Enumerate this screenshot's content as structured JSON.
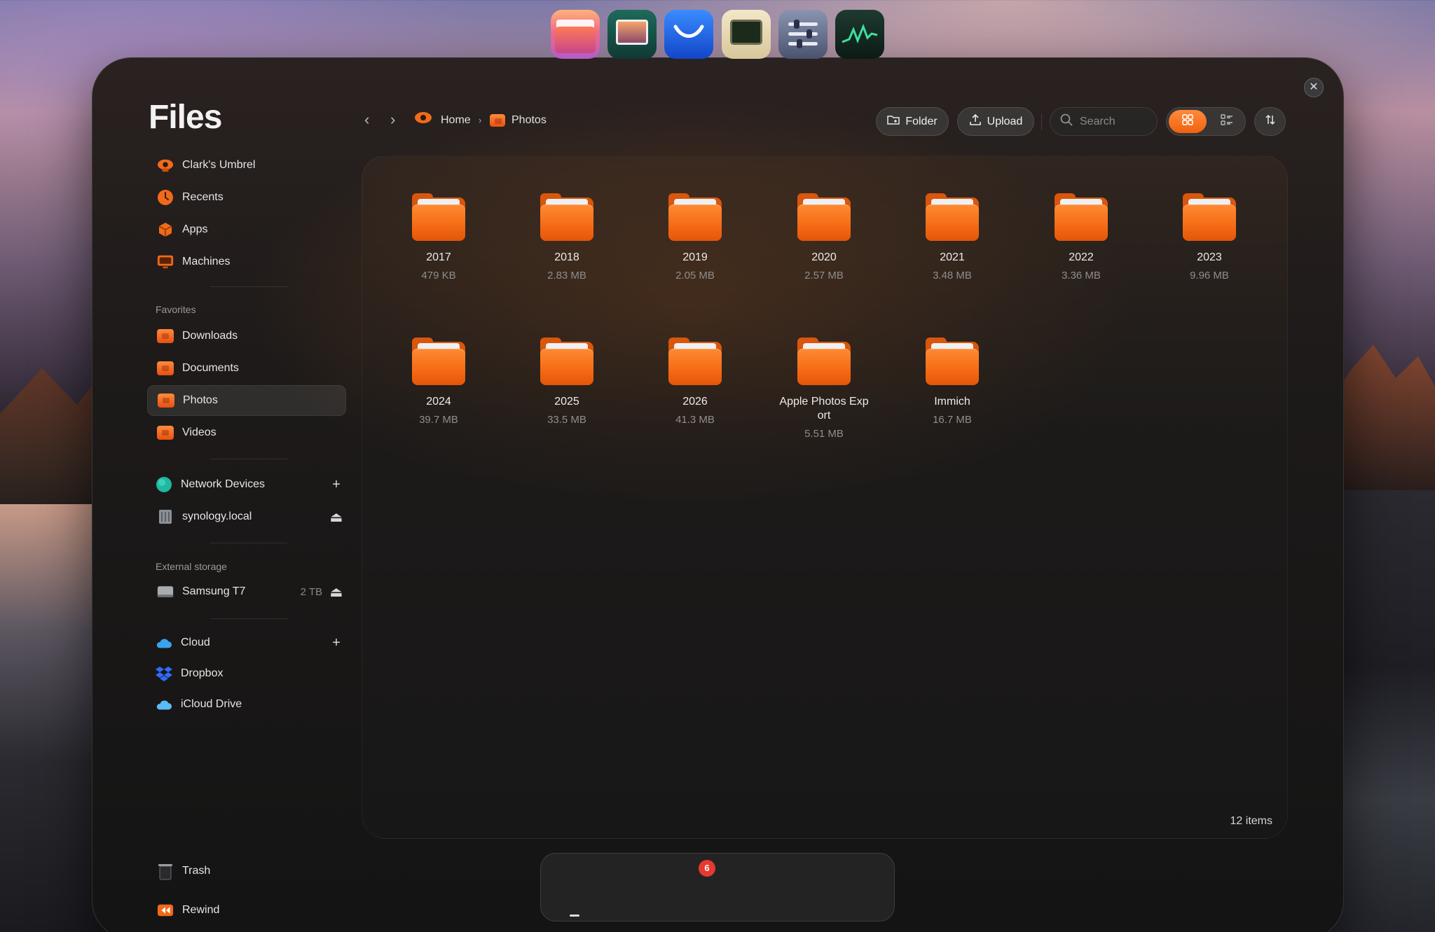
{
  "window": {
    "app_title": "Files"
  },
  "sidebar": {
    "main": [
      {
        "label": "Clark's Umbrel",
        "icon": "umbrel-logo-icon"
      },
      {
        "label": "Recents",
        "icon": "clock-icon"
      },
      {
        "label": "Apps",
        "icon": "apps-cube-icon"
      },
      {
        "label": "Machines",
        "icon": "monitor-icon"
      }
    ],
    "favorites_heading": "Favorites",
    "favorites": [
      {
        "label": "Downloads"
      },
      {
        "label": "Documents"
      },
      {
        "label": "Photos",
        "active": true
      },
      {
        "label": "Videos"
      }
    ],
    "network": {
      "heading_label": "Network Devices",
      "device_label": "synology.local"
    },
    "external_heading": "External storage",
    "external": {
      "label": "Samsung T7",
      "size": "2 TB"
    },
    "cloud": {
      "heading_label": "Cloud",
      "items": [
        {
          "label": "Dropbox"
        },
        {
          "label": "iCloud Drive"
        }
      ]
    },
    "trash_label": "Trash",
    "rewind_label": "Rewind"
  },
  "toolbar": {
    "breadcrumb": [
      {
        "label": "Home"
      },
      {
        "label": "Photos"
      }
    ],
    "folder_button": "Folder",
    "upload_button": "Upload",
    "search_placeholder": "Search",
    "view_mode": "grid"
  },
  "files": [
    {
      "name": "2017",
      "size": "479 KB"
    },
    {
      "name": "2018",
      "size": "2.83 MB"
    },
    {
      "name": "2019",
      "size": "2.05 MB"
    },
    {
      "name": "2020",
      "size": "2.57 MB"
    },
    {
      "name": "2021",
      "size": "3.48 MB"
    },
    {
      "name": "2022",
      "size": "3.36 MB"
    },
    {
      "name": "2023",
      "size": "9.96 MB"
    },
    {
      "name": "2024",
      "size": "39.7 MB"
    },
    {
      "name": "2025",
      "size": "33.5 MB"
    },
    {
      "name": "2026",
      "size": "41.3 MB"
    },
    {
      "name_line1": "Apple Photos Exp",
      "name_line2": "ort",
      "size": "5.51 MB"
    },
    {
      "name": "Immich",
      "size": "16.7 MB"
    }
  ],
  "status": {
    "items_count": "12 items"
  },
  "dock": {
    "apps": [
      "files-app-icon",
      "photos-app-icon",
      "mail-app-icon",
      "terminal-app-icon",
      "settings-app-icon",
      "activity-monitor-app-icon"
    ],
    "mail_badge": "6"
  },
  "colors": {
    "accent": "#f46a14",
    "folder": "#ff8a33"
  }
}
